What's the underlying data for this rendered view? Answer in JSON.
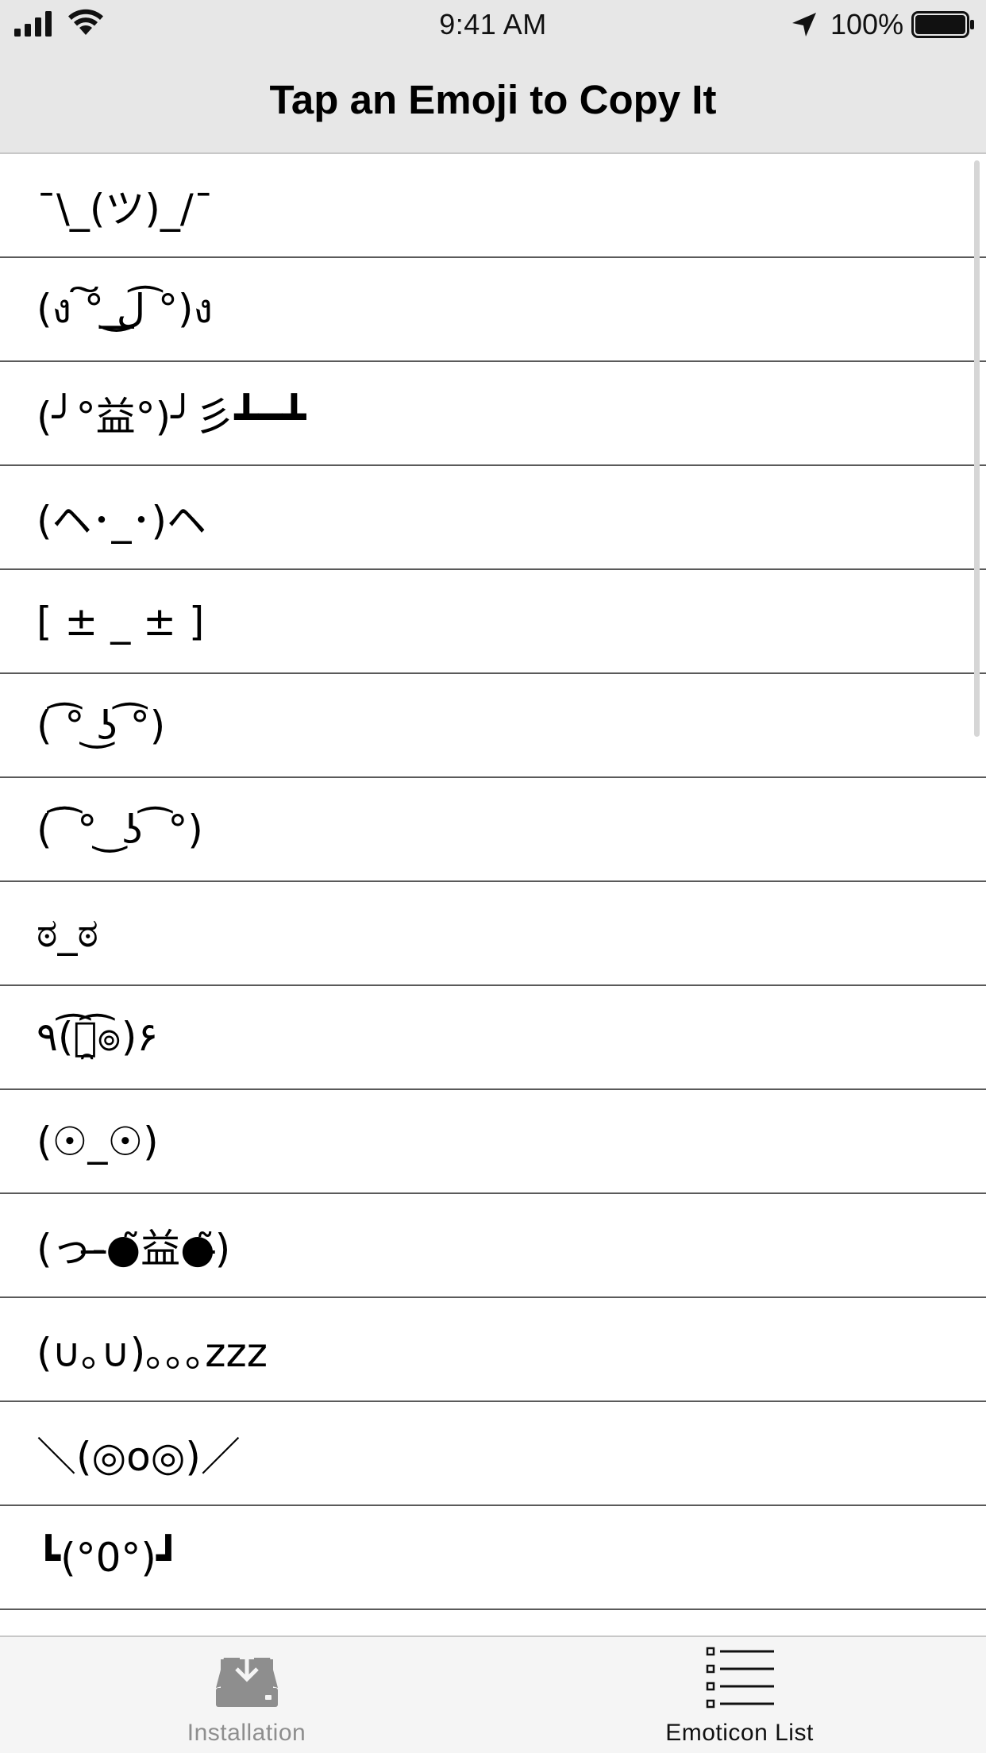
{
  "status_bar": {
    "time": "9:41 AM",
    "battery_percent": "100%",
    "battery_level": 1.0
  },
  "nav": {
    "title": "Tap an Emoji to Copy It"
  },
  "emoticons": [
    "¯\\_(ツ)_/¯",
    "(ง ͠° ͟ل͜ ͡°)ง",
    "(╯°益°)╯彡┻━┻",
    "(ヘ･_･)ヘ",
    "[ ± _ ± ]",
    "( ͡° ͜ʖ ͡°)",
    "( ͡͡ ° ͜ ʖ ͡ °)",
    "ಠ_ಠ",
    "٩(͡๏̯͡๏)۶",
    "(☉_☉)",
    "(っ-̶●̃益●̶̃)",
    "(∪｡∪)｡｡｡zzz",
    "＼(◎o◎)／",
    "┗(°0°)┛"
  ],
  "tabs": [
    {
      "label": "Installation",
      "icon": "download-tray-icon",
      "selected": false
    },
    {
      "label": "Emoticon List",
      "icon": "list-icon",
      "selected": true
    }
  ],
  "colors": {
    "header_bg": "#e7e7e7",
    "tab_bar_bg": "#f5f5f5",
    "tab_inactive": "#8e8e8e",
    "tab_active": "#111111",
    "separator": "#5a5a5a"
  }
}
